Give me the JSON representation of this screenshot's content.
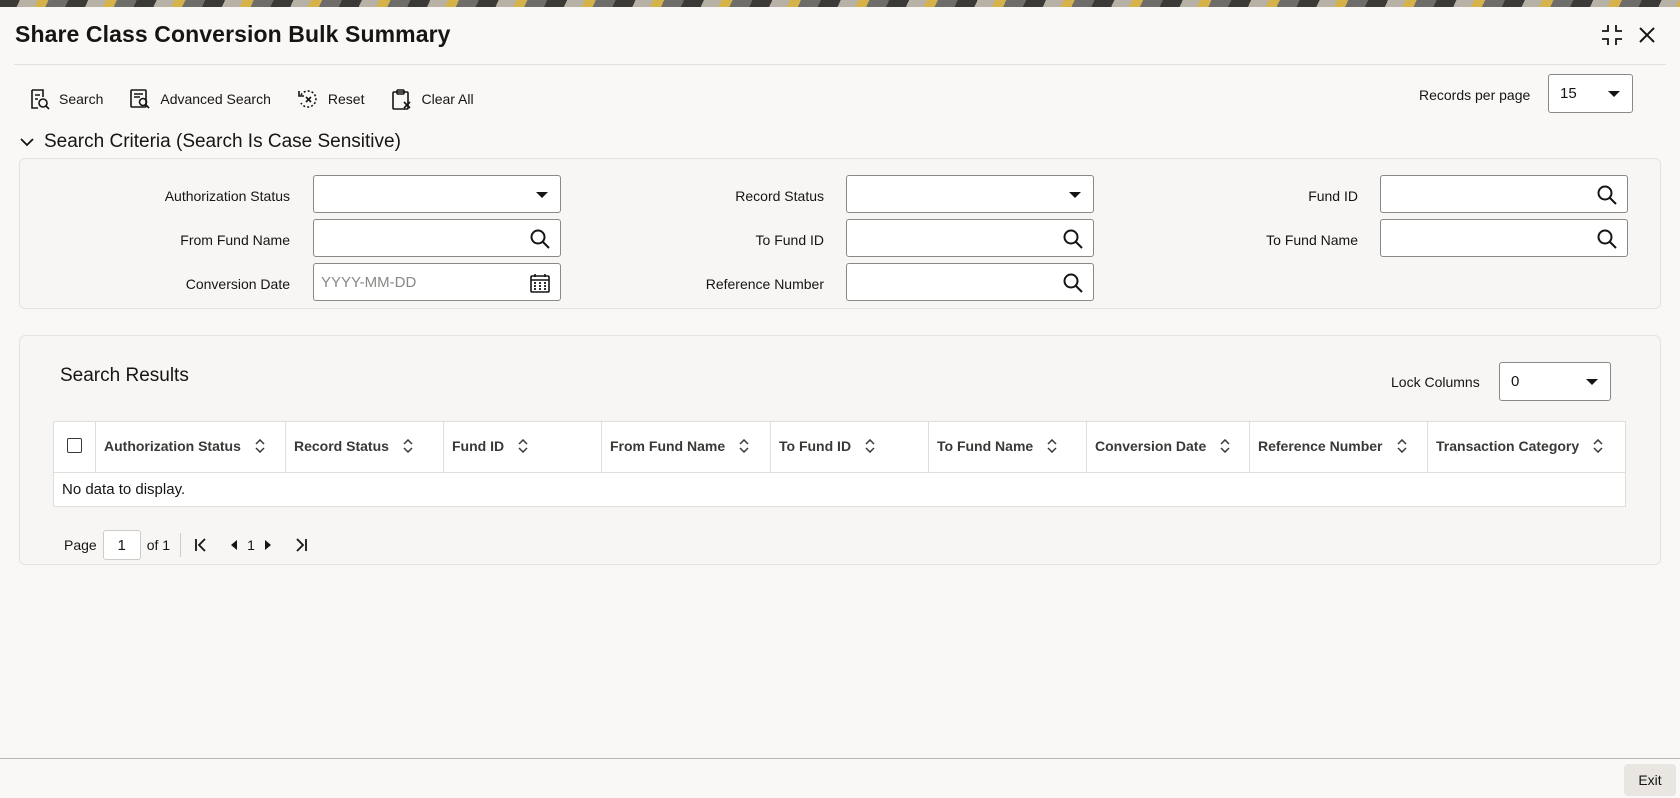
{
  "window": {
    "title": "Share Class Conversion Bulk Summary"
  },
  "toolbar": {
    "search_label": "Search",
    "advanced_search_label": "Advanced Search",
    "reset_label": "Reset",
    "clear_all_label": "Clear All",
    "records_per_page_label": "Records per page",
    "records_per_page_value": "15"
  },
  "criteria": {
    "header": "Search Criteria (Search Is Case Sensitive)",
    "authorization_status_label": "Authorization Status",
    "authorization_status_value": "",
    "record_status_label": "Record Status",
    "record_status_value": "",
    "fund_id_label": "Fund ID",
    "from_fund_name_label": "From Fund Name",
    "to_fund_id_label": "To Fund ID",
    "to_fund_name_label": "To Fund Name",
    "conversion_date_label": "Conversion Date",
    "conversion_date_placeholder": "YYYY-MM-DD",
    "reference_number_label": "Reference Number"
  },
  "results": {
    "title": "Search Results",
    "lock_columns_label": "Lock Columns",
    "lock_columns_value": "0",
    "columns": [
      "Authorization Status",
      "Record Status",
      "Fund ID",
      "From Fund Name",
      "To Fund ID",
      "To Fund Name",
      "Conversion Date",
      "Reference Number",
      "Transaction Category"
    ],
    "empty_message": "No data to display."
  },
  "pager": {
    "page_label": "Page",
    "page_value": "1",
    "of_label": "of 1",
    "current_page": "1"
  },
  "footer": {
    "exit_label": "Exit"
  }
}
